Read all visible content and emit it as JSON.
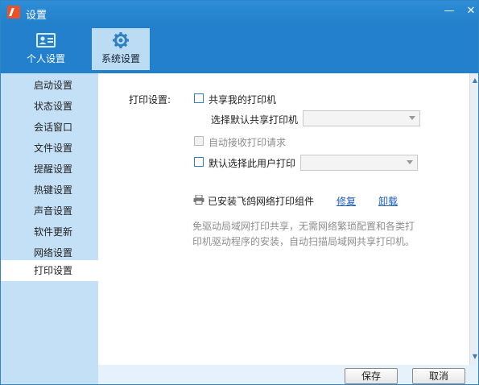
{
  "window": {
    "title": "设置"
  },
  "tabs": [
    {
      "label": "个人设置",
      "icon": "id-card-icon",
      "active": false
    },
    {
      "label": "系统设置",
      "icon": "gear-icon",
      "active": true
    }
  ],
  "sidebar": {
    "items": [
      {
        "label": "启动设置"
      },
      {
        "label": "状态设置"
      },
      {
        "label": "会话窗口"
      },
      {
        "label": "文件设置"
      },
      {
        "label": "提醒设置"
      },
      {
        "label": "热键设置"
      },
      {
        "label": "声音设置"
      },
      {
        "label": "软件更新"
      },
      {
        "label": "网络设置"
      },
      {
        "label": "打印设置",
        "active": true
      }
    ]
  },
  "print": {
    "section_label": "打印设置:",
    "share_printer": {
      "label": "共享我的打印机",
      "checked": false
    },
    "default_shared": {
      "label": "选择默认共享打印机",
      "value": ""
    },
    "auto_accept": {
      "label": "自动接收打印请求",
      "checked": false,
      "disabled": true
    },
    "default_user": {
      "label": "默认选择此用户打印",
      "checked": false,
      "value": ""
    },
    "component": {
      "status": "已安装飞鸽网络打印组件",
      "repair": "修复",
      "uninstall": "卸载"
    },
    "description_line1": "免驱动局域网打印共享，无需网络繁琐配置和各类打",
    "description_line2": "印机驱动程序的安装，自动扫描局域网共享打印机。"
  },
  "footer": {
    "save": "保存",
    "cancel": "取消"
  },
  "colors": {
    "title_bar": "#2280cc",
    "sidebar": "#c4e0f6",
    "link": "#1a5ab8"
  }
}
